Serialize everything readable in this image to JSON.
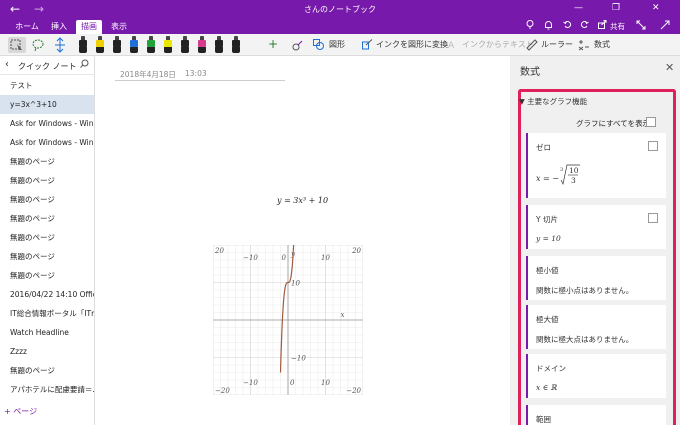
{
  "titlebar": {
    "back_glyph": "←",
    "forward_glyph": "→",
    "title": "さんのノートブック",
    "controls": {
      "minimize": "—",
      "restore": "❐",
      "close": "✕"
    }
  },
  "tabs": [
    {
      "label": "ホーム",
      "active": false
    },
    {
      "label": "挿入",
      "active": false
    },
    {
      "label": "描画",
      "active": true
    },
    {
      "label": "表示",
      "active": false
    }
  ],
  "tabbar_right": {
    "share": "共有"
  },
  "ribbon": {
    "add": "+",
    "shapes": "図形",
    "ink_to_shape": "インクを図形に変換",
    "ink_to_text": "インクからテキスト",
    "ruler": "ルーラー",
    "math": "数式",
    "pens": [
      {
        "color": "#222222"
      },
      {
        "color": "#f0d000"
      },
      {
        "color": "#222222"
      },
      {
        "color": "#1e6fd9"
      },
      {
        "color": "#22a23a"
      },
      {
        "color": "#e8e800"
      },
      {
        "color": "#222222"
      },
      {
        "color": "#d83a8c"
      },
      {
        "color": "#222222"
      },
      {
        "color": "#222222"
      }
    ]
  },
  "sidebar": {
    "title": "クイック ノート",
    "pages": [
      {
        "label": "テスト",
        "active": false
      },
      {
        "label": "y=3x^3+10",
        "active": true
      },
      {
        "label": "Ask for Windows - Win...",
        "active": false
      },
      {
        "label": "Ask for Windows - Win...",
        "active": false
      },
      {
        "label": "無題のページ",
        "active": false
      },
      {
        "label": "無題のページ",
        "active": false
      },
      {
        "label": "無題のページ",
        "active": false
      },
      {
        "label": "無題のページ",
        "active": false
      },
      {
        "label": "無題のページ",
        "active": false
      },
      {
        "label": "無題のページ",
        "active": false
      },
      {
        "label": "無題のページ",
        "active": false
      },
      {
        "label": "2016/04/22 14:10 Offic...",
        "active": false
      },
      {
        "label": "IT総合情報ポータル「ITm...",
        "active": false
      },
      {
        "label": "Watch Headline",
        "active": false
      },
      {
        "label": "Zzzz",
        "active": false
      },
      {
        "label": "無題のページ",
        "active": false
      },
      {
        "label": "アパホテルに配慮要請＝...",
        "active": false
      }
    ],
    "add_page": "+ ページ"
  },
  "page": {
    "date": "2018年4月18日",
    "time": "13:03",
    "equation": "y = 3x³ + 10"
  },
  "chart_data": {
    "type": "line",
    "function": "y = 3x^3 + 10",
    "xlim": [
      -20,
      20
    ],
    "ylim": [
      -20,
      20
    ],
    "x_ticks": [
      "−10",
      "0",
      "10"
    ],
    "y_ticks": [
      "20",
      "10",
      "−10",
      "−20"
    ],
    "corner_labels": {
      "top_left": "20",
      "top_right": "20",
      "bottom_left": "−20",
      "bottom_right": "−20"
    },
    "xlabel": "x",
    "ylabel": "y",
    "grid": true,
    "series": [
      {
        "color": "#a05a3c"
      }
    ]
  },
  "panel": {
    "title": "数式",
    "section_title": "▼ 主要なグラフ機能",
    "show_all": "グラフにすべてを表示",
    "cards": [
      {
        "title": "ゼロ",
        "value": "x = −∛(10/3)",
        "checkbox": true
      },
      {
        "title": "Y 切片",
        "value": "y = 10",
        "checkbox": true
      },
      {
        "title": "極小値",
        "value": "関数に極小点はありません。",
        "checkbox": false
      },
      {
        "title": "極大値",
        "value": "関数に極大点はありません。",
        "checkbox": false
      },
      {
        "title": "ドメイン",
        "value": "x ∈ ℝ",
        "checkbox": false
      },
      {
        "title": "範囲",
        "value": "",
        "checkbox": false
      }
    ]
  }
}
